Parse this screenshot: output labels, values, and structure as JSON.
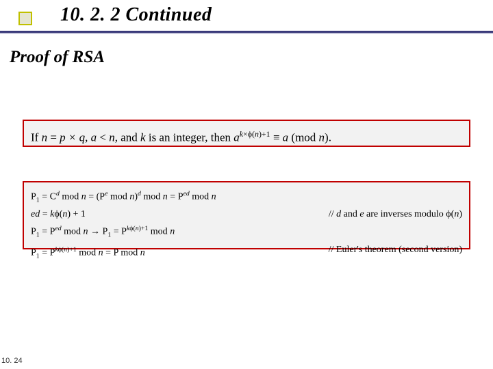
{
  "heading": "10. 2. 2  Continued",
  "subheading": "Proof of RSA",
  "box1": {
    "prefix": "If ",
    "cond1_lhs": "n",
    "cond1_rhs": "p × q",
    "cond2_lhs": "a",
    "cond2_rhs": "n",
    "mid1": ", and ",
    "kvar": "k",
    "mid2": " is an integer, then ",
    "base": "a",
    "exp_k": "k",
    "exp_phi": "×ϕ(",
    "exp_n": "n",
    "exp_tail": ")+1",
    "congr": " ≡ ",
    "rhs_a": "a",
    "mod_open": " (mod ",
    "mod_n": "n",
    "mod_close": ").",
    "eq": " = ",
    "lt": " < "
  },
  "box2": {
    "line1": {
      "p1": "P",
      "sub1": "1",
      "eq": " = C",
      "d": "d",
      "t1": " mod ",
      "n1": "n",
      "t2": " = (P",
      "e": "e",
      "t3": " mod ",
      "n2": "n",
      "t4": ")",
      "d2": "d",
      "t5": " mod ",
      "n3": "n",
      "t6": " = P",
      "ed": "ed",
      "t7": " mod ",
      "n4": "n"
    },
    "line2": {
      "left_ed": "ed",
      "left_eq": " = ",
      "left_k": "k",
      "left_phi": "ϕ(",
      "left_n": "n",
      "left_tail": ") + 1",
      "comment_pre": "// ",
      "d": "d",
      "and": " and ",
      "e": "e",
      "tail": " are inverses modulo ϕ(",
      "n": "n",
      "close": ")"
    },
    "line3": {
      "p1": "P",
      "s1": "1",
      "eq1": " = P",
      "ed": "ed",
      "m1": " mod ",
      "n1": "n",
      "arrow": "  →  ",
      "p2": "P",
      "s2": "1",
      "eq2": " = P",
      "k": "k",
      "phi": "ϕ(",
      "nn": "n",
      "tail": ")+1",
      "m2": " mod ",
      "n2": "n"
    },
    "line4": {
      "left_p1": "P",
      "left_s1": "1",
      "left_eq": " = P",
      "left_k": "k",
      "left_phi": "ϕ(",
      "left_n": "n",
      "left_tail": ")+1",
      "left_m": " mod ",
      "left_n2": "n",
      "left_eq2": " =   P mod ",
      "left_n3": "n",
      "comment": "// Euler's theorem (second version)"
    }
  },
  "footer": "10. 24"
}
